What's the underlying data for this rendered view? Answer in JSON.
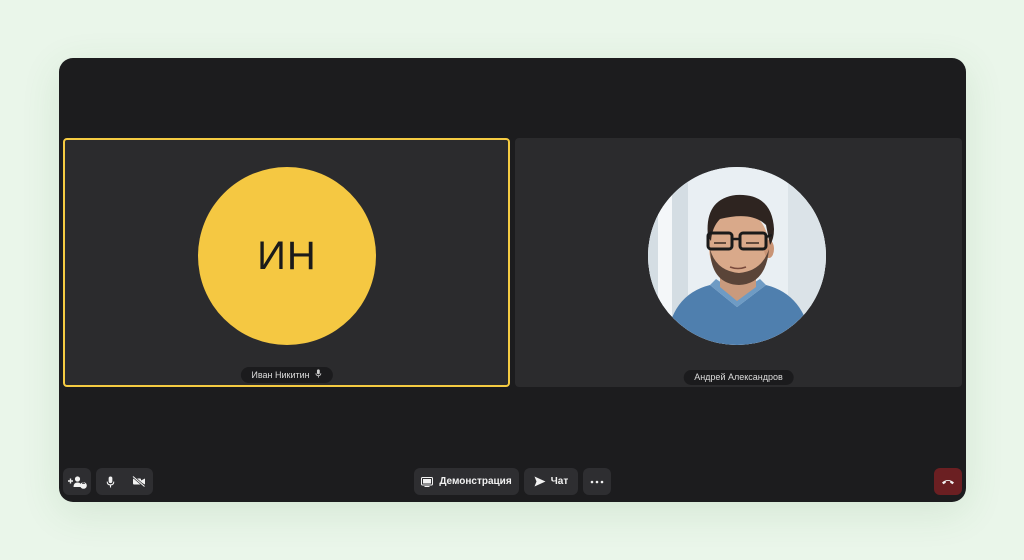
{
  "participants": [
    {
      "name": "Иван Никитин",
      "initials": "ИН",
      "avatar_color": "#f5c842",
      "active_speaker": true,
      "mic_icon": "microphone-icon"
    },
    {
      "name": "Андрей Александров",
      "avatar": "photo"
    }
  ],
  "toolbar": {
    "participants_count": "2",
    "screen_share_label": "Демонстрация",
    "chat_label": "Чат"
  },
  "colors": {
    "background": "#eaf6ea",
    "window": "#1c1c1e",
    "tile": "#2b2b2d",
    "active_border": "#f5cb42",
    "end_call": "#6b1f22"
  },
  "icons": [
    "add-participant-icon",
    "microphone-icon",
    "camera-off-icon",
    "screen-share-icon",
    "chat-send-icon",
    "more-icon",
    "end-call-icon"
  ]
}
